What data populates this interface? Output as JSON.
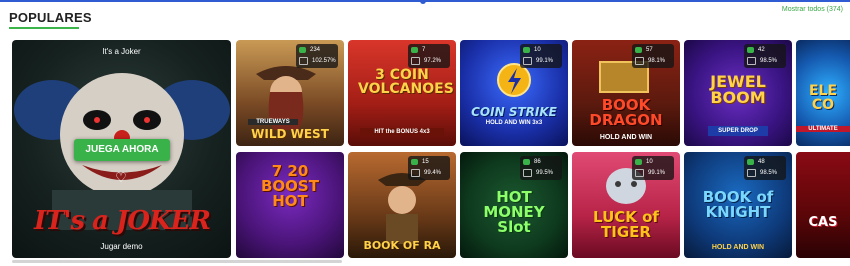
{
  "section": {
    "title": "POPULARES",
    "show_all": "Mostrar todos (374)"
  },
  "featured": {
    "name": "It's a Joker",
    "play_label": "JUEGA AHORA",
    "demo_label": "Jugar demo",
    "logo": "IT's a JOKER"
  },
  "games": [
    {
      "title": "WILD WEST",
      "tag": "TRUEWAYS",
      "players": "234",
      "rtp": "102.57%"
    },
    {
      "title": "3 COIN VOLCANOES",
      "tag": "HIT the BONUS 4x3",
      "players": "7",
      "rtp": "97.2%"
    },
    {
      "title": "COIN STRIKE",
      "tag": "HOLD AND WIN 3x3",
      "players": "10",
      "rtp": "99.1%"
    },
    {
      "title": "BOOK DRAGON",
      "tag": "HOLD AND WIN",
      "players": "57",
      "rtp": "98.1%"
    },
    {
      "title": "JEWEL BOOM",
      "tag": "SUPER DROP",
      "players": "42",
      "rtp": "98.5%"
    },
    {
      "title": "ELE CO",
      "tag": "ULTIMATE"
    },
    {
      "title": "7 20 BOOST HOT",
      "tag": ""
    },
    {
      "title": "BOOK OF RA",
      "tag": "",
      "players": "15",
      "rtp": "99.4%"
    },
    {
      "title": "HOT MONEY Slot",
      "tag": "",
      "players": "86",
      "rtp": "99.5%"
    },
    {
      "title": "LUCK of TIGER",
      "tag": "",
      "players": "10",
      "rtp": "99.1%"
    },
    {
      "title": "BOOK of KNIGHT",
      "tag": "HOLD AND WIN",
      "players": "48",
      "rtp": "98.5%"
    },
    {
      "title": "CAS",
      "tag": ""
    }
  ]
}
